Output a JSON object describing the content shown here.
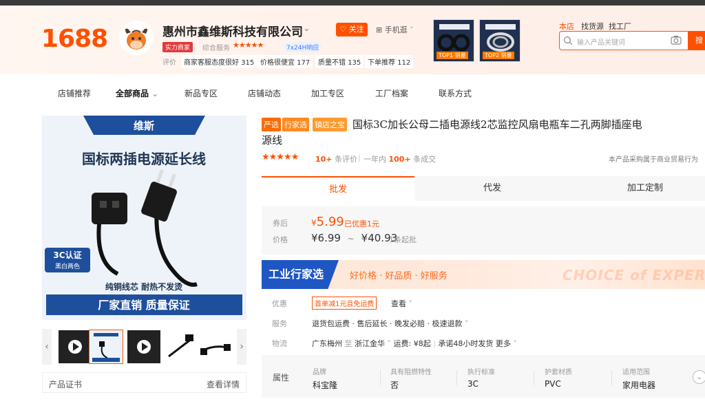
{
  "header": {
    "logo": "1688",
    "shop_name": "惠州市鑫维斯科技有限公司",
    "follow": "关注",
    "mobile": "手机逛",
    "badge": "实力商家",
    "service_label": "综合服务",
    "service_stars": "★★★★★",
    "online": "7x24H响应",
    "rating_label": "评价",
    "tags": [
      "商家客服态度很好 315",
      "价格很便宜 177",
      "质量不错 135",
      "下单推荐 112"
    ],
    "thumbs": [
      {
        "label": "TOP1 销量"
      },
      {
        "label": "TOP2 销量"
      }
    ],
    "search_tabs": [
      "本店",
      "找货源",
      "找工厂"
    ],
    "search_placeholder": "输入产品关键词",
    "search_button": "搜"
  },
  "nav": [
    "店铺推荐",
    "全部商品",
    "新品专区",
    "店铺动态",
    "加工专区",
    "工厂档案",
    "联系方式"
  ],
  "gallery": {
    "brand": "维斯",
    "headline": "国标两插电源延长线",
    "cert": "3C认证",
    "colors": "黑白两色",
    "feature": "纯铜线芯 耐热不发烫",
    "slogan": "厂家直销 质量保证",
    "cert_row_label": "产品证书",
    "cert_row_link": "查看详情"
  },
  "product": {
    "pills": [
      "严选",
      "行家选",
      "镇店之宝"
    ],
    "title": "国标3C加长公母二插电源线2芯监控风扇电瓶车二孔两脚插座电源线",
    "stars": "★★★★★",
    "reviews_num": "10+",
    "reviews_label": "条评价",
    "sold_prefix": "一年内",
    "sold_num": "100+",
    "sold_label": "条成交",
    "trade_note": "本产品采购属于商业贸易行为"
  },
  "tabs": [
    "批发",
    "代发",
    "加工定制"
  ],
  "price": {
    "coupon_label": "券后",
    "coupon_currency": "¥",
    "coupon_value": "5.99",
    "coupon_note": "已优惠1元",
    "price_label": "价格",
    "low": "¥6.99",
    "tilde": "~",
    "high": "¥40.93",
    "min_order": "1条起批"
  },
  "banner": {
    "left": "工业行家选",
    "slogan": "好价格 · 好品质 · 好服务",
    "watermark": "CHOICE of EXPERT"
  },
  "info": {
    "offer_label": "优惠",
    "offer_tag": "首单减1元且免运费",
    "offer_link": "查看",
    "service_label": "服务",
    "service_text": "退货包运费 · 售后延长 · 晚发必赔 · 极速退款",
    "logistics_label": "物流",
    "route_from": "广东梅州",
    "route_to_word": "至",
    "route_to": "浙江金华",
    "freight": "运费: ¥8起",
    "promise": "承诺48小时发货",
    "more": "更多"
  },
  "attrs": {
    "title": "属性",
    "items": [
      {
        "k": "品牌",
        "v": "科宝隆"
      },
      {
        "k": "具有阻燃特性",
        "v": "否"
      },
      {
        "k": "执行标准",
        "v": "3C"
      },
      {
        "k": "护套材质",
        "v": "PVC"
      },
      {
        "k": "适用范围",
        "v": "家用电器"
      }
    ]
  }
}
